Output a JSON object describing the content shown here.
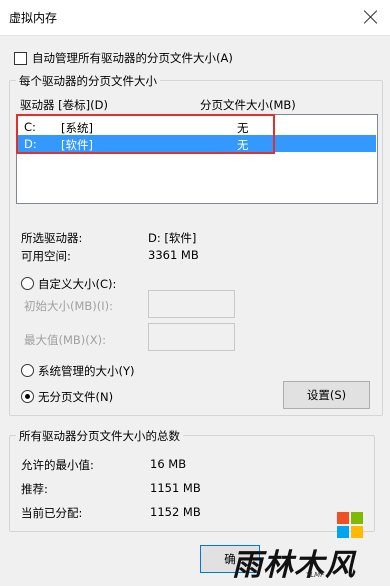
{
  "window": {
    "title": "虚拟内存"
  },
  "auto_manage": {
    "label": "自动管理所有驱动器的分页文件大小(A)",
    "checked": false
  },
  "per_drive": {
    "legend": "每个驱动器的分页文件大小",
    "col_drive": "驱动器 [卷标](D)",
    "col_size": "分页文件大小(MB)",
    "rows": [
      {
        "drive": "C:",
        "label": "[系统]",
        "size": "无",
        "selected": false
      },
      {
        "drive": "D:",
        "label": "[软件]",
        "size": "无",
        "selected": true
      }
    ],
    "selected_label": "所选驱动器:",
    "selected_value": "D:  [软件]",
    "free_label": "可用空间:",
    "free_value": "3361 MB",
    "custom_label": "自定义大小(C):",
    "initial_label": "初始大小(MB)(I):",
    "initial_value": "",
    "max_label": "最大值(MB)(X):",
    "max_value": "",
    "system_label": "系统管理的大小(Y)",
    "none_label": "无分页文件(N)",
    "set_button": "设置(S)",
    "selected_option": "none"
  },
  "total": {
    "legend": "所有驱动器分页文件大小的总数",
    "min_label": "允许的最小值:",
    "min_value": "16 MB",
    "rec_label": "推荐:",
    "rec_value": "1151 MB",
    "cur_label": "当前已分配:",
    "cur_value": "1152 MB"
  },
  "footer": {
    "ok_button_partial": "确"
  },
  "watermark": {
    "brand": "雨林木风",
    "sub": "YLMF",
    "colors": [
      "#f25022",
      "#7fba00",
      "#00a4ef",
      "#ffb900"
    ]
  }
}
